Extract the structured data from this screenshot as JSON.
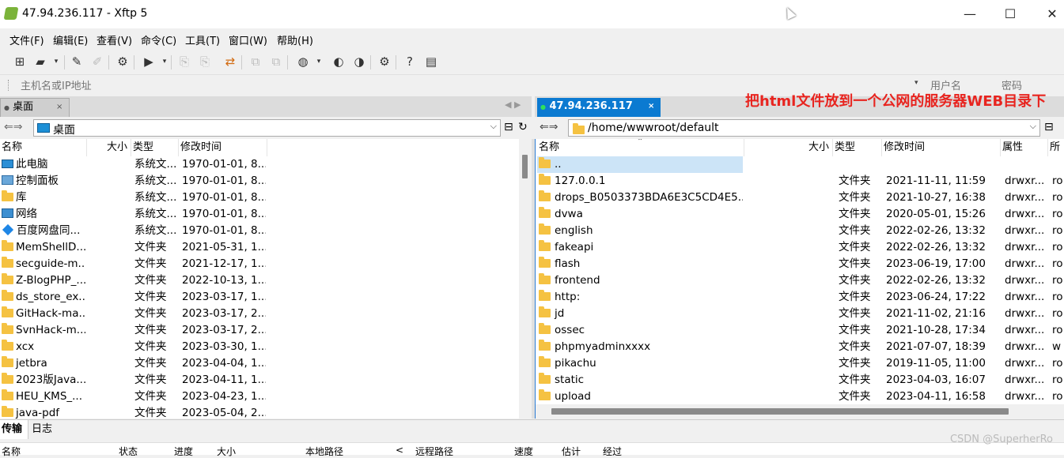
{
  "window": {
    "title": "47.94.236.117    - Xftp 5",
    "minimize": "—",
    "maximize": "☐",
    "close": "✕"
  },
  "menu": [
    "文件(F)",
    "编辑(E)",
    "查看(V)",
    "命令(C)",
    "工具(T)",
    "窗口(W)",
    "帮助(H)"
  ],
  "address": {
    "host_placeholder": "主机名或IP地址",
    "user_placeholder": "用户名",
    "pass_placeholder": "密码"
  },
  "left": {
    "tab": "桌面",
    "path": "桌面",
    "headers": [
      "名称",
      "大小",
      "类型",
      "修改时间"
    ],
    "rows": [
      {
        "icon": "computer-icon",
        "name": "此电脑",
        "size": "",
        "type": "系统文...",
        "date": "1970-01-01, 8..."
      },
      {
        "icon": "control-panel-icon",
        "name": "控制面板",
        "size": "",
        "type": "系统文...",
        "date": "1970-01-01, 8..."
      },
      {
        "icon": "folder-icon",
        "name": "库",
        "size": "",
        "type": "系统文...",
        "date": "1970-01-01, 8..."
      },
      {
        "icon": "network-icon",
        "name": "网络",
        "size": "",
        "type": "系统文...",
        "date": "1970-01-01, 8..."
      },
      {
        "icon": "baidu-netdisk-icon",
        "name": "百度网盘同...",
        "size": "",
        "type": "系统文...",
        "date": "1970-01-01, 8..."
      },
      {
        "icon": "folder-icon",
        "name": "MemShellD...",
        "size": "",
        "type": "文件夹",
        "date": "2021-05-31, 1..."
      },
      {
        "icon": "folder-icon",
        "name": "secguide-m...",
        "size": "",
        "type": "文件夹",
        "date": "2021-12-17, 1..."
      },
      {
        "icon": "folder-icon",
        "name": "Z-BlogPHP_...",
        "size": "",
        "type": "文件夹",
        "date": "2022-10-13, 1..."
      },
      {
        "icon": "folder-icon",
        "name": "ds_store_ex...",
        "size": "",
        "type": "文件夹",
        "date": "2023-03-17, 1..."
      },
      {
        "icon": "folder-icon",
        "name": "GitHack-ma...",
        "size": "",
        "type": "文件夹",
        "date": "2023-03-17, 2..."
      },
      {
        "icon": "folder-icon",
        "name": "SvnHack-m...",
        "size": "",
        "type": "文件夹",
        "date": "2023-03-17, 2..."
      },
      {
        "icon": "folder-icon",
        "name": "xcx",
        "size": "",
        "type": "文件夹",
        "date": "2023-03-30, 1..."
      },
      {
        "icon": "folder-icon",
        "name": "jetbra",
        "size": "",
        "type": "文件夹",
        "date": "2023-04-04, 1..."
      },
      {
        "icon": "folder-icon",
        "name": "2023版Java...",
        "size": "",
        "type": "文件夹",
        "date": "2023-04-11, 1..."
      },
      {
        "icon": "folder-icon",
        "name": "HEU_KMS_...",
        "size": "",
        "type": "文件夹",
        "date": "2023-04-23, 1..."
      },
      {
        "icon": "folder-icon",
        "name": "java-pdf",
        "size": "",
        "type": "文件夹",
        "date": "2023-05-04, 2..."
      }
    ]
  },
  "right": {
    "tab": "47.94.236.117",
    "path": "/home/wwwroot/default",
    "headers": [
      "名称",
      "大小",
      "类型",
      "修改时间",
      "属性",
      "所"
    ],
    "rows": [
      {
        "name": "..",
        "size": "",
        "type": "",
        "date": "",
        "attr": "",
        "owner": ""
      },
      {
        "name": "127.0.0.1",
        "size": "",
        "type": "文件夹",
        "date": "2021-11-11, 11:59",
        "attr": "drwxr...",
        "owner": "ro"
      },
      {
        "name": "drops_B0503373BDA6E3C5CD4E5...",
        "size": "",
        "type": "文件夹",
        "date": "2021-10-27, 16:38",
        "attr": "drwxr...",
        "owner": "ro"
      },
      {
        "name": "dvwa",
        "size": "",
        "type": "文件夹",
        "date": "2020-05-01, 15:26",
        "attr": "drwxr...",
        "owner": "ro"
      },
      {
        "name": "english",
        "size": "",
        "type": "文件夹",
        "date": "2022-02-26, 13:32",
        "attr": "drwxr...",
        "owner": "ro"
      },
      {
        "name": "fakeapi",
        "size": "",
        "type": "文件夹",
        "date": "2022-02-26, 13:32",
        "attr": "drwxr...",
        "owner": "ro"
      },
      {
        "name": "flash",
        "size": "",
        "type": "文件夹",
        "date": "2023-06-19, 17:00",
        "attr": "drwxr...",
        "owner": "ro"
      },
      {
        "name": "frontend",
        "size": "",
        "type": "文件夹",
        "date": "2022-02-26, 13:32",
        "attr": "drwxr...",
        "owner": "ro"
      },
      {
        "name": "http:",
        "size": "",
        "type": "文件夹",
        "date": "2023-06-24, 17:22",
        "attr": "drwxr...",
        "owner": "ro"
      },
      {
        "name": "jd",
        "size": "",
        "type": "文件夹",
        "date": "2021-11-02, 21:16",
        "attr": "drwxr...",
        "owner": "ro"
      },
      {
        "name": "ossec",
        "size": "",
        "type": "文件夹",
        "date": "2021-10-28, 17:34",
        "attr": "drwxr...",
        "owner": "ro"
      },
      {
        "name": "phpmyadminxxxx",
        "size": "",
        "type": "文件夹",
        "date": "2021-07-07, 18:39",
        "attr": "drwxr...",
        "owner": "w"
      },
      {
        "name": "pikachu",
        "size": "",
        "type": "文件夹",
        "date": "2019-11-05, 11:00",
        "attr": "drwxr...",
        "owner": "ro"
      },
      {
        "name": "static",
        "size": "",
        "type": "文件夹",
        "date": "2023-04-03, 16:07",
        "attr": "drwxr...",
        "owner": "ro"
      },
      {
        "name": "upload",
        "size": "",
        "type": "文件夹",
        "date": "2023-04-11, 16:58",
        "attr": "drwxr...",
        "owner": "ro"
      }
    ]
  },
  "annotation": "把html文件放到一个公网的服务器WEB目录下",
  "bottom": {
    "tabs": [
      "传输",
      "日志"
    ],
    "headers": [
      "名称",
      "状态",
      "进度",
      "大小",
      "本地路径",
      "<",
      "远程路径",
      "速度",
      "估计",
      "经过"
    ]
  },
  "watermark": "CSDN @SuperherRo",
  "colors": {
    "selection": "#cce4f7",
    "active_tab": "#0b7ad1",
    "annotation": "#e8241f",
    "folder": "#f5c242"
  }
}
